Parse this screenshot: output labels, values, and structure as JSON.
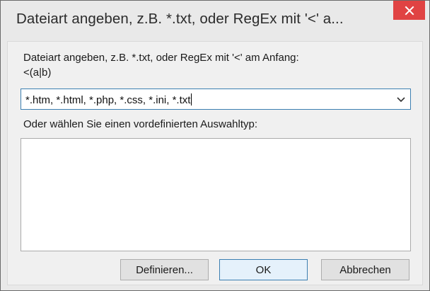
{
  "window": {
    "title": "Dateiart angeben, z.B. *.txt, oder RegEx mit '<' a...",
    "close_icon": "close-icon"
  },
  "dialog": {
    "prompt_line1": "Dateiart angeben, z.B. *.txt, oder RegEx mit '<' am Anfang:",
    "prompt_line2": "<(a|b)",
    "filetype_value": "*.htm, *.html, *.php, *.css, *.ini, *.txt",
    "dropdown_icon": "chevron-down-icon",
    "predefined_label": "Oder wählen Sie einen vordefinierten Auswahltyp:",
    "predefined_items": []
  },
  "buttons": {
    "define_label": "Definieren...",
    "ok_label": "OK",
    "cancel_label": "Abbrechen"
  },
  "colors": {
    "close_button": "#e04343",
    "focus_border": "#3c7fb1",
    "window_background": "#e9e9e9",
    "client_background": "#f0f0f0"
  }
}
